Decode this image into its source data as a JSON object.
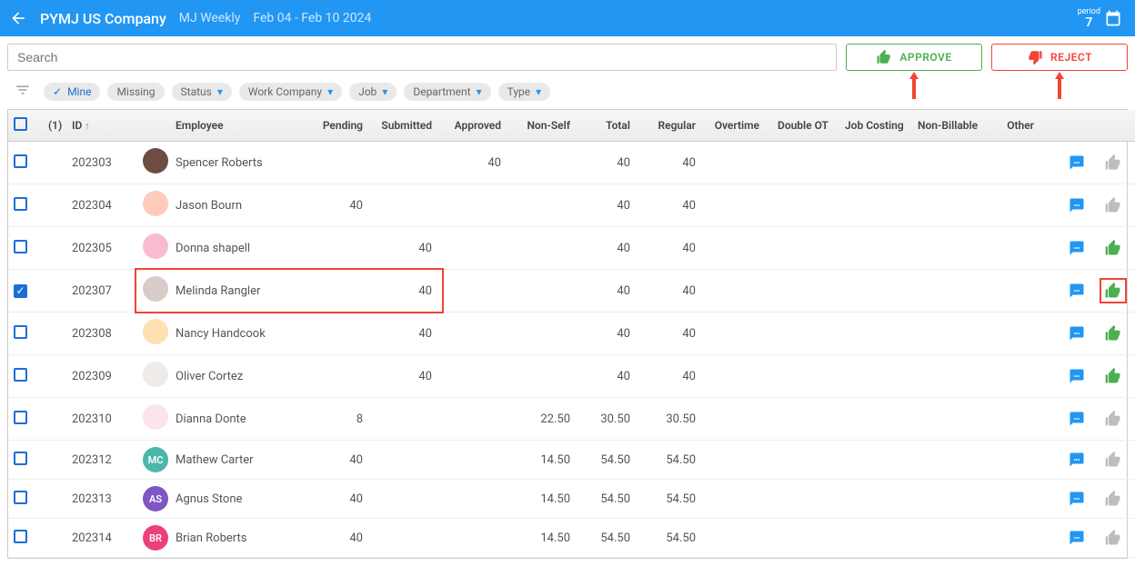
{
  "header": {
    "company": "PYMJ US Company",
    "schedule": "MJ Weekly",
    "date_range": "Feb 04 - Feb 10   2024",
    "period_label": "period",
    "period_value": "7"
  },
  "actions": {
    "search_placeholder": "Search",
    "approve_label": "APPROVE",
    "reject_label": "REJECT"
  },
  "filters": {
    "mine": "Mine",
    "missing": "Missing",
    "status": "Status",
    "work_company": "Work Company",
    "job": "Job",
    "department": "Department",
    "type": "Type"
  },
  "columns": {
    "count": "(1)",
    "id": "ID",
    "employee": "Employee",
    "pending": "Pending",
    "submitted": "Submitted",
    "approved": "Approved",
    "non_self": "Non-Self",
    "total": "Total",
    "regular": "Regular",
    "overtime": "Overtime",
    "double_ot": "Double OT",
    "job_costing": "Job Costing",
    "non_billable": "Non-Billable",
    "other": "Other"
  },
  "rows": [
    {
      "checked": false,
      "id": "202303",
      "name": "Spencer Roberts",
      "avatar_bg": "#6d4c41",
      "initials": "",
      "pending": "",
      "submitted": "",
      "approved": "40",
      "non_self": "",
      "total": "40",
      "regular": "40",
      "up_state": "grey",
      "down_state": "red"
    },
    {
      "checked": false,
      "id": "202304",
      "name": "Jason Bourn",
      "avatar_bg": "#ffccbc",
      "initials": "",
      "pending": "40",
      "submitted": "",
      "approved": "",
      "non_self": "",
      "total": "40",
      "regular": "40",
      "up_state": "grey",
      "down_state": "grey"
    },
    {
      "checked": false,
      "id": "202305",
      "name": "Donna shapell",
      "avatar_bg": "#f8bbd0",
      "initials": "",
      "pending": "",
      "submitted": "40",
      "approved": "",
      "non_self": "",
      "total": "40",
      "regular": "40",
      "up_state": "green",
      "down_state": "red"
    },
    {
      "checked": true,
      "id": "202307",
      "name": "Melinda Rangler",
      "avatar_bg": "#d7ccc8",
      "initials": "",
      "pending": "",
      "submitted": "40",
      "approved": "",
      "non_self": "",
      "total": "40",
      "regular": "40",
      "up_state": "green",
      "down_state": "red",
      "hl_left": true,
      "hl_right": true
    },
    {
      "checked": false,
      "id": "202308",
      "name": "Nancy Handcook",
      "avatar_bg": "#ffe0b2",
      "initials": "",
      "pending": "",
      "submitted": "40",
      "approved": "",
      "non_self": "",
      "total": "40",
      "regular": "40",
      "up_state": "green",
      "down_state": "red"
    },
    {
      "checked": false,
      "id": "202309",
      "name": "Oliver Cortez",
      "avatar_bg": "#efebe9",
      "initials": "",
      "pending": "",
      "submitted": "40",
      "approved": "",
      "non_self": "",
      "total": "40",
      "regular": "40",
      "up_state": "green",
      "down_state": "red"
    },
    {
      "checked": false,
      "id": "202310",
      "name": "Dianna Donte",
      "avatar_bg": "#fce4ec",
      "initials": "",
      "pending": "8",
      "submitted": "",
      "approved": "",
      "non_self": "22.50",
      "total": "30.50",
      "regular": "30.50",
      "up_state": "grey",
      "down_state": "grey"
    },
    {
      "checked": false,
      "id": "202312",
      "name": "Mathew Carter",
      "avatar_bg": "#4db6ac",
      "initials": "MC",
      "pending": "40",
      "submitted": "",
      "approved": "",
      "non_self": "14.50",
      "total": "54.50",
      "regular": "54.50",
      "up_state": "grey",
      "down_state": "grey"
    },
    {
      "checked": false,
      "id": "202313",
      "name": "Agnus Stone",
      "avatar_bg": "#7e57c2",
      "initials": "AS",
      "pending": "40",
      "submitted": "",
      "approved": "",
      "non_self": "14.50",
      "total": "54.50",
      "regular": "54.50",
      "up_state": "grey",
      "down_state": "grey"
    },
    {
      "checked": false,
      "id": "202314",
      "name": "Brian Roberts",
      "avatar_bg": "#ec407a",
      "initials": "BR",
      "pending": "40",
      "submitted": "",
      "approved": "",
      "non_self": "14.50",
      "total": "54.50",
      "regular": "54.50",
      "up_state": "grey",
      "down_state": "grey"
    }
  ]
}
